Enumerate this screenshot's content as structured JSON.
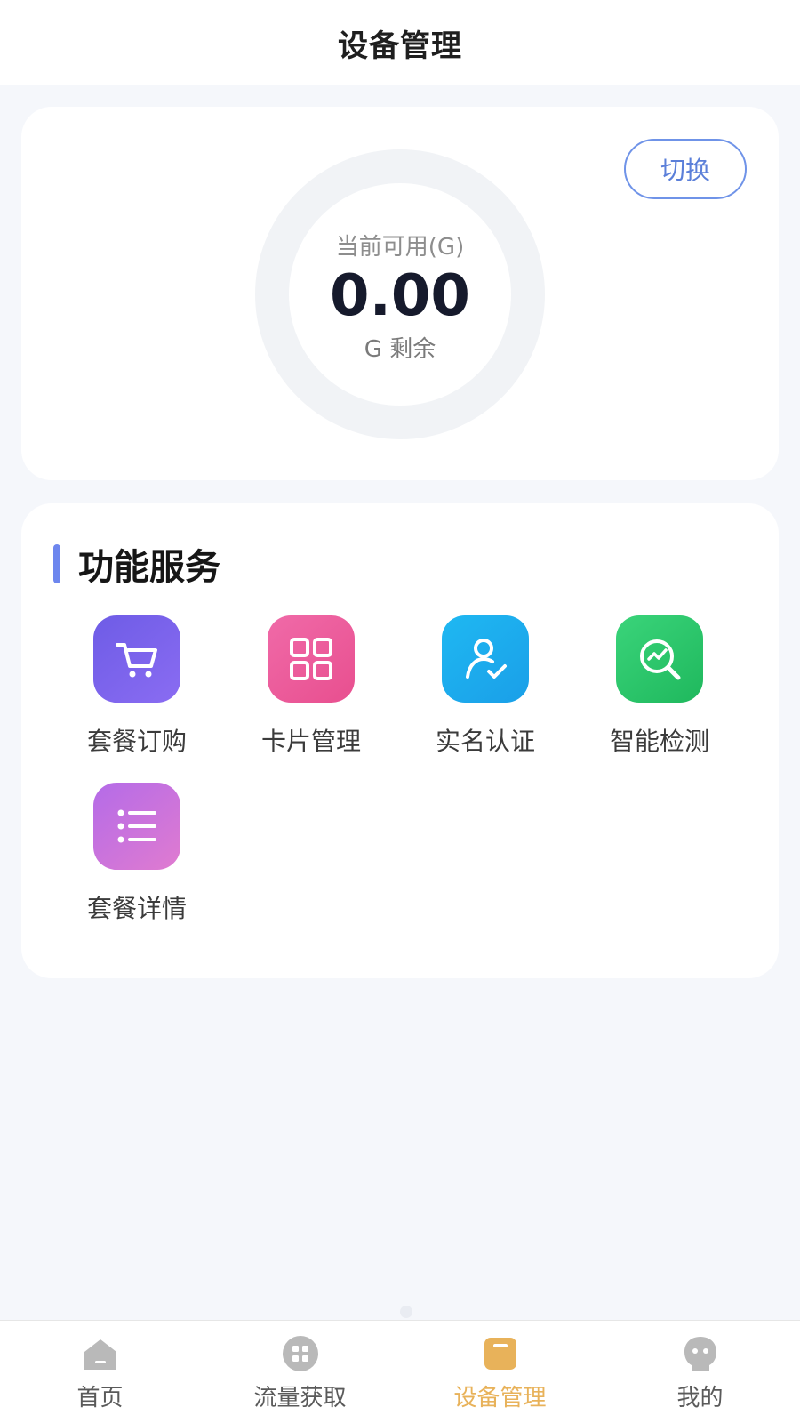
{
  "header": {
    "title": "设备管理"
  },
  "balance": {
    "switch_label": "切换",
    "label": "当前可用(G)",
    "value": "0.00",
    "unit": "G 剩余"
  },
  "services": {
    "title": "功能服务",
    "items": [
      {
        "label": "套餐订购",
        "icon": "shopping-cart-icon",
        "color": "#7462ea"
      },
      {
        "label": "卡片管理",
        "icon": "grid-icon",
        "color": "#ee5f9e"
      },
      {
        "label": "实名认证",
        "icon": "user-check-icon",
        "color": "#1cadee"
      },
      {
        "label": "智能检测",
        "icon": "search-chart-icon",
        "color": "#2cc86c"
      },
      {
        "label": "套餐详情",
        "icon": "list-icon",
        "color": "#c673de"
      }
    ]
  },
  "tabbar": {
    "items": [
      {
        "label": "首页",
        "icon": "home-icon",
        "active": false
      },
      {
        "label": "流量获取",
        "icon": "apps-icon",
        "active": false
      },
      {
        "label": "设备管理",
        "icon": "device-icon",
        "active": true
      },
      {
        "label": "我的",
        "icon": "profile-icon",
        "active": false
      }
    ],
    "active_color": "#e8b25a",
    "inactive_color": "#b9b9b9"
  }
}
